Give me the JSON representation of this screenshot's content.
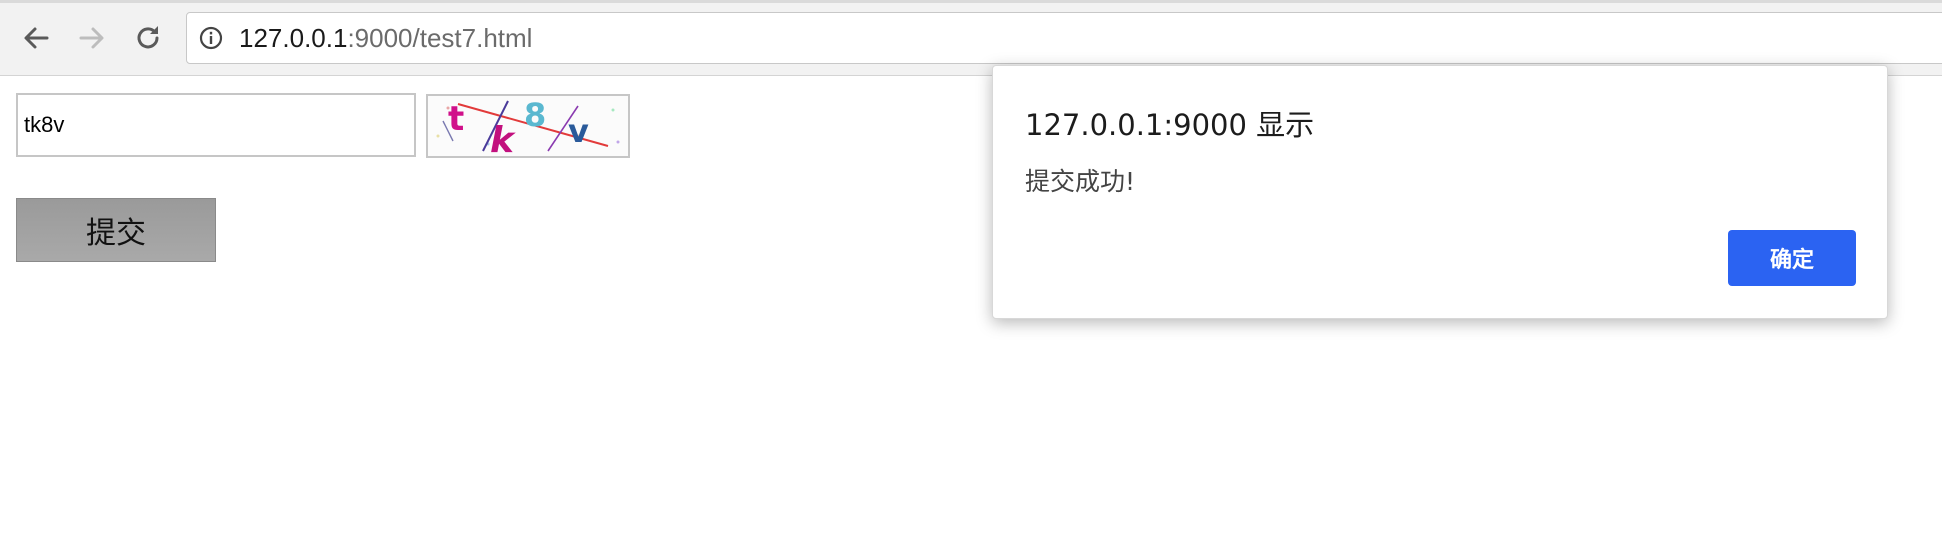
{
  "browser": {
    "url_host": "127.0.0.1",
    "url_rest": ":9000/test7.html",
    "back_icon": "back-arrow-icon",
    "forward_icon": "forward-arrow-icon",
    "reload_icon": "reload-icon",
    "site_info_icon": "info-icon"
  },
  "page": {
    "captcha_input_value": "tk8v",
    "captcha_image_text": "tk8v",
    "submit_label": "提交"
  },
  "dialog": {
    "title": "127.0.0.1:9000 显示",
    "message": "提交成功!",
    "ok_label": "确定",
    "ok_color": "#2b63f2"
  }
}
